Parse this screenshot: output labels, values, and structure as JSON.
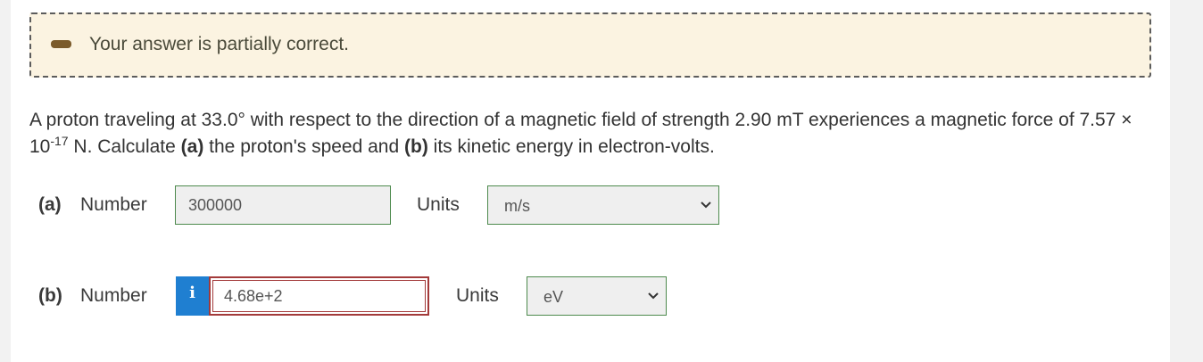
{
  "feedback": {
    "icon": "minus-icon",
    "text": "Your answer is partially correct."
  },
  "question": {
    "line1_prefix": "A proton traveling at 33.0° with respect to the direction of a magnetic field of strength 2.90 mT experiences a magnetic force of 7.57 × ",
    "base": "10",
    "exponent": "-17",
    "after_exponent": " N. Calculate ",
    "part_a_marker": "(a)",
    "part_a_text": " the proton's speed and ",
    "part_b_marker": "(b)",
    "part_b_text": " its kinetic energy in electron-volts."
  },
  "part_a": {
    "label": "(a)",
    "number_label": "Number",
    "value": "300000",
    "units_label": "Units",
    "unit_selected": "m/s"
  },
  "part_b": {
    "label": "(b)",
    "number_label": "Number",
    "info_icon": "i",
    "value": "4.68e+2",
    "units_label": "Units",
    "unit_selected": "eV"
  },
  "colors": {
    "feedback_bg": "#fbf3e1",
    "correct_border": "#4d8a4d",
    "incorrect_border": "#a33a3a",
    "info_blue": "#1f7fd1"
  }
}
